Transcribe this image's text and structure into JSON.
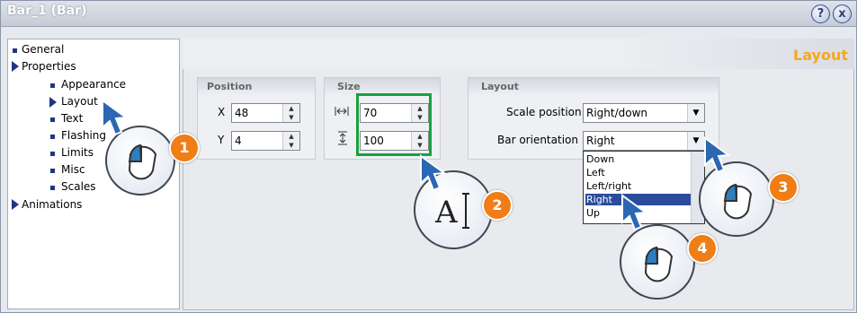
{
  "window": {
    "title": "Bar_1 (Bar)"
  },
  "title_buttons": {
    "help_glyph": "?",
    "close_glyph": "x"
  },
  "tree": {
    "general": "General",
    "properties": "Properties",
    "appearance": "Appearance",
    "layout": "Layout",
    "text": "Text",
    "flashing": "Flashing",
    "limits": "Limits",
    "misc": "Misc",
    "scales": "Scales",
    "animations": "Animations"
  },
  "pane": {
    "title": "Layout"
  },
  "position": {
    "label": "Position",
    "x_label": "X",
    "x_value": "48",
    "y_label": "Y",
    "y_value": "4"
  },
  "size": {
    "label": "Size",
    "width_value": "70",
    "height_value": "100"
  },
  "layout": {
    "label": "Layout",
    "scale_position_label": "Scale position",
    "scale_position_value": "Right/down",
    "bar_orientation_label": "Bar orientation",
    "bar_orientation_value": "Right",
    "options": [
      "Down",
      "Left",
      "Left/right",
      "Right",
      "Up"
    ],
    "selected_option": "Right"
  },
  "steps": [
    "1",
    "2",
    "3",
    "4"
  ],
  "colors": {
    "highlight": "#17a23d",
    "step_badge": "#f07d16",
    "selection": "#2a4d9b",
    "title_accent": "#f6a71b"
  }
}
